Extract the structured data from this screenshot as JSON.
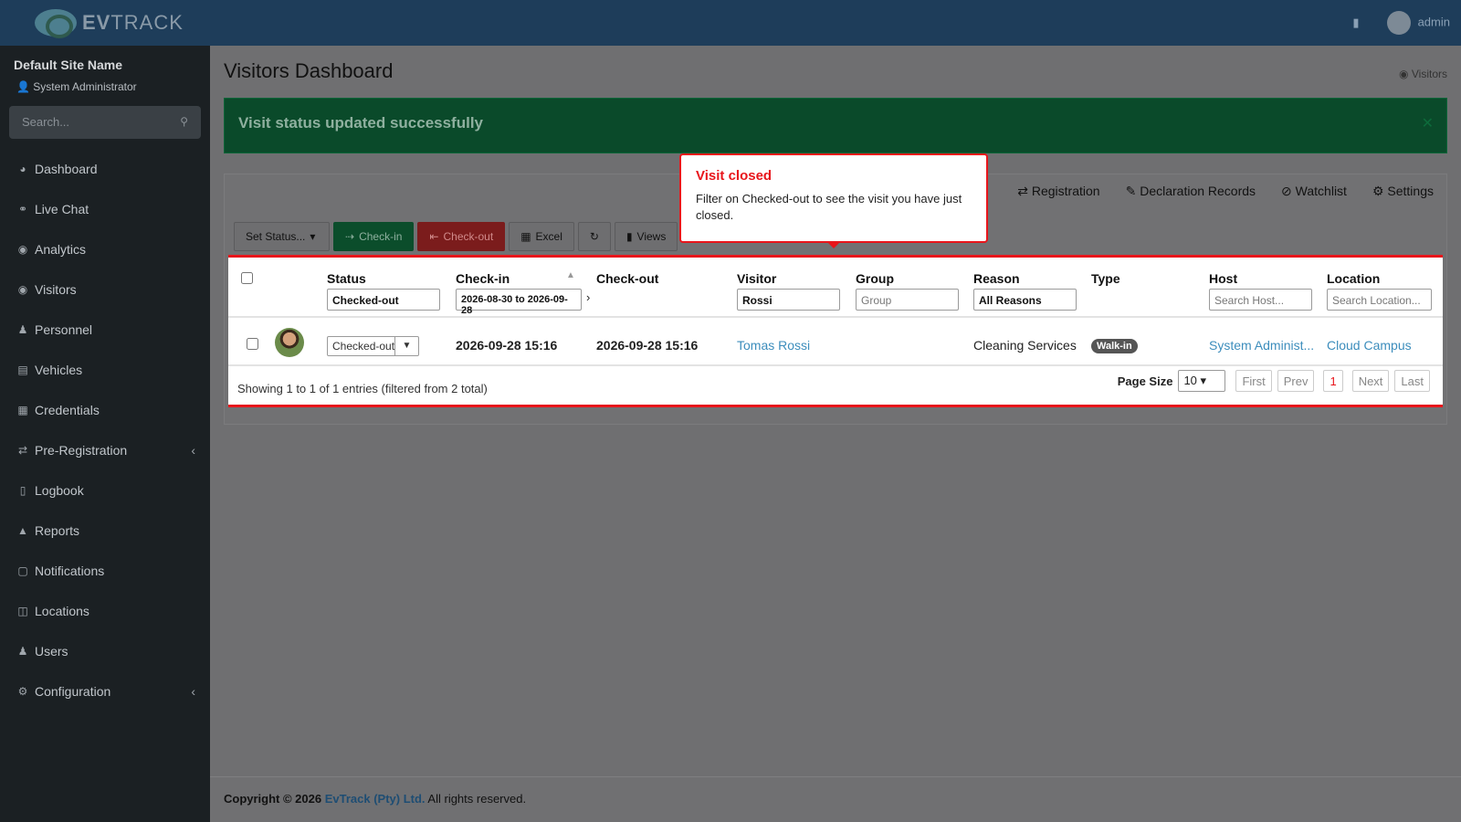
{
  "header": {
    "brand_a": "EV",
    "brand_b": "TRACK",
    "user": "admin"
  },
  "sidebar": {
    "site_name": "Default Site Name",
    "role": "System Administrator",
    "search_placeholder": "Search...",
    "items": [
      {
        "label": "Dashboard",
        "icon": "dashboard-icon"
      },
      {
        "label": "Live Chat",
        "icon": "headset-icon"
      },
      {
        "label": "Analytics",
        "icon": "analytics-icon"
      },
      {
        "label": "Visitors",
        "icon": "eye-icon"
      },
      {
        "label": "Personnel",
        "icon": "personnel-icon"
      },
      {
        "label": "Vehicles",
        "icon": "vehicle-icon"
      },
      {
        "label": "Credentials",
        "icon": "credentials-icon"
      },
      {
        "label": "Pre-Registration",
        "icon": "arrows-icon",
        "has_chevron": true
      },
      {
        "label": "Logbook",
        "icon": "book-icon"
      },
      {
        "label": "Reports",
        "icon": "reports-icon"
      },
      {
        "label": "Notifications",
        "icon": "notifications-icon"
      },
      {
        "label": "Locations",
        "icon": "building-icon"
      },
      {
        "label": "Users",
        "icon": "users-icon"
      },
      {
        "label": "Configuration",
        "icon": "gear-icon",
        "has_chevron": true
      }
    ]
  },
  "page": {
    "title": "Visitors Dashboard",
    "breadcrumb": "Visitors"
  },
  "alert": {
    "message": "Visit status updated successfully"
  },
  "tabs": [
    "Registration",
    "Declaration Records",
    "Watchlist",
    "Settings"
  ],
  "toolbar": {
    "set_status": "Set Status...",
    "checkin": "Check-in",
    "checkout": "Check-out",
    "excel": "Excel",
    "views": "Views"
  },
  "table": {
    "columns": [
      "Status",
      "Check-in",
      "Check-out",
      "Visitor",
      "Group",
      "Reason",
      "Type",
      "Host",
      "Location"
    ],
    "filters": {
      "status": "Checked-out",
      "checkin": "2026-08-30 to 2026-09-28",
      "visitor": "Rossi",
      "group_placeholder": "Group",
      "reason": "All Reasons",
      "host_placeholder": "Search Host...",
      "location_placeholder": "Search Location..."
    },
    "rows": [
      {
        "status": "Checked-out",
        "checkin": "2026-09-28 15:16",
        "checkout": "2026-09-28 15:16",
        "visitor": "Tomas Rossi",
        "group": "",
        "reason": "Cleaning Services",
        "type": "Walk-in",
        "host": "System Administ...",
        "location": "Cloud Campus"
      }
    ],
    "summary": "Showing 1 to 1 of 1 entries (filtered from 2 total)",
    "page_size_label": "Page Size",
    "page_size": "10",
    "pager": {
      "first": "First",
      "prev": "Prev",
      "current": "1",
      "next": "Next",
      "last": "Last"
    }
  },
  "popover": {
    "title": "Visit closed",
    "body": "Filter on Checked-out to see the visit you have just closed."
  },
  "footer": {
    "prefix": "Copyright © 2026 ",
    "company": "EvTrack (Pty) Ltd.",
    "suffix": " All rights reserved."
  },
  "colors": {
    "accent_red": "#e8151b",
    "link": "#3c8dbc",
    "success": "#0a4a2a"
  }
}
